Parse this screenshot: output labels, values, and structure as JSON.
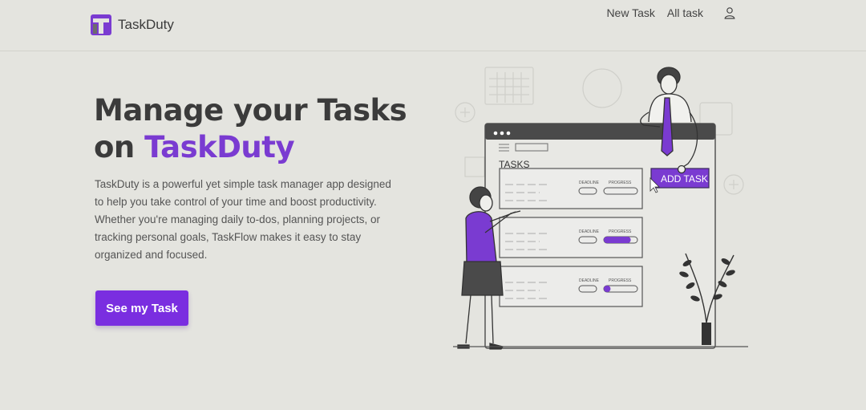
{
  "header": {
    "logo_text": "TaskDuty",
    "nav": {
      "new_task": "New Task",
      "all_task": "All task"
    }
  },
  "hero": {
    "title_line1": "Manage your Tasks",
    "title_on": "on ",
    "title_brand": "TaskDuty",
    "description": "TaskDuty is a powerful yet simple task manager app designed to help you take control of your time and boost productivity. Whether you're managing daily to-dos, planning projects, or tracking personal goals, TaskFlow makes it easy to stay organized and focused.",
    "cta_label": "See my Task"
  },
  "illustration": {
    "tasks_label": "TASKS",
    "add_task_label": "ADD TASK",
    "deadline_label": "DEADLINE",
    "progress_label": "PROGRESS",
    "progress_values": [
      0,
      0.8,
      0.2
    ]
  },
  "colors": {
    "brand": "#7a3bd1",
    "cta": "#7a2ee0",
    "background": "#e4e4df"
  },
  "icons": {
    "logo": "taskduty-logo-icon",
    "user": "user-icon"
  }
}
